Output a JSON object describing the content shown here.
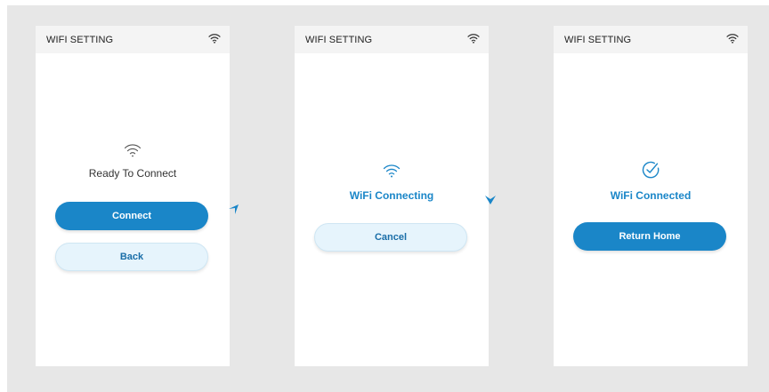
{
  "colors": {
    "accent": "#1a86c8",
    "secondary_bg": "#e6f4fc",
    "page_bg": "#e7e7e7"
  },
  "screens": [
    {
      "status_title": "WIFI SETTING",
      "icon": "wifi-icon",
      "message": "Ready To Connect",
      "buttons": [
        {
          "label": "Connect",
          "style": "primary"
        },
        {
          "label": "Back",
          "style": "secondary"
        }
      ]
    },
    {
      "status_title": "WIFI SETTING",
      "icon": "wifi-icon",
      "message": "WiFi Connecting",
      "buttons": [
        {
          "label": "Cancel",
          "style": "secondary"
        }
      ]
    },
    {
      "status_title": "WIFI SETTING",
      "icon": "check-circle-icon",
      "message": "WiFi Connected",
      "buttons": [
        {
          "label": "Return Home",
          "style": "primary"
        }
      ]
    }
  ]
}
